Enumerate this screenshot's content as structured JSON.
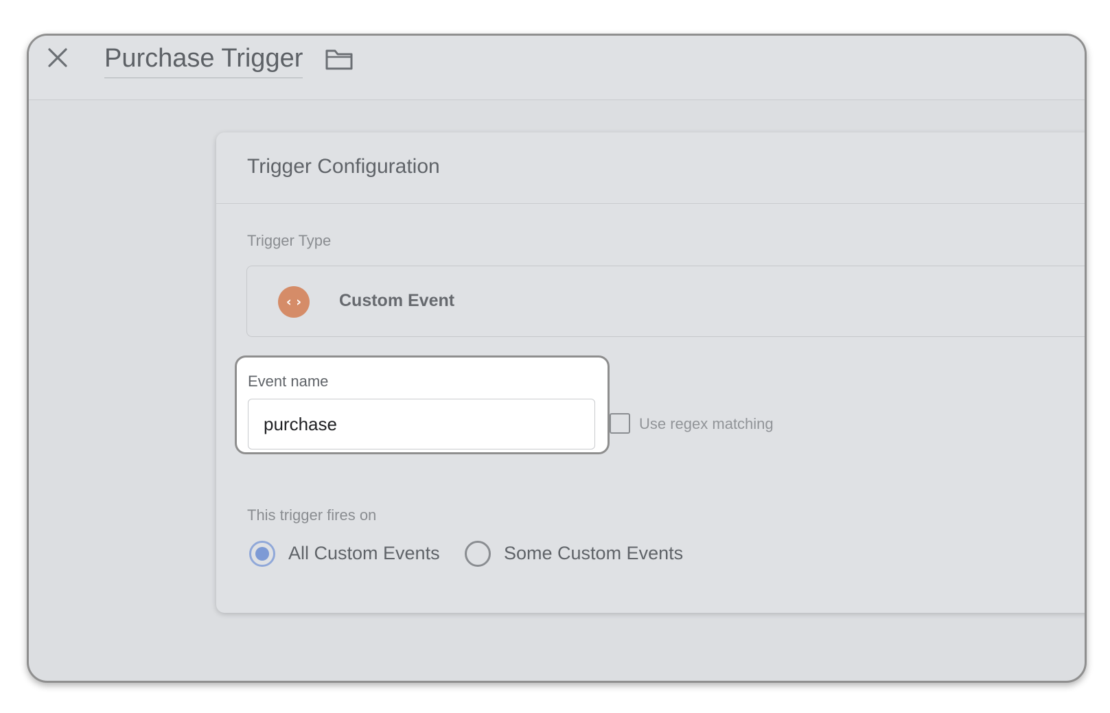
{
  "header": {
    "title": "Purchase Trigger",
    "close_icon": "close-icon",
    "folder_icon": "folder-icon"
  },
  "card": {
    "title": "Trigger Configuration",
    "trigger_type_label": "Trigger Type",
    "trigger_type": {
      "name": "Custom Event",
      "icon": "code-brackets-icon",
      "icon_glyph": "‹ ›",
      "icon_color": "#d58c68"
    },
    "event_name": {
      "label": "Event name",
      "value": "purchase"
    },
    "regex": {
      "label": "Use regex matching",
      "checked": false
    },
    "fires_on": {
      "label": "This trigger fires on",
      "options": [
        {
          "label": "All Custom Events",
          "selected": true
        },
        {
          "label": "Some Custom Events",
          "selected": false
        }
      ]
    }
  },
  "colors": {
    "background": "#dcdee1",
    "radio_selected": "#7d9ad5",
    "highlight_border": "#8e8e8e"
  }
}
